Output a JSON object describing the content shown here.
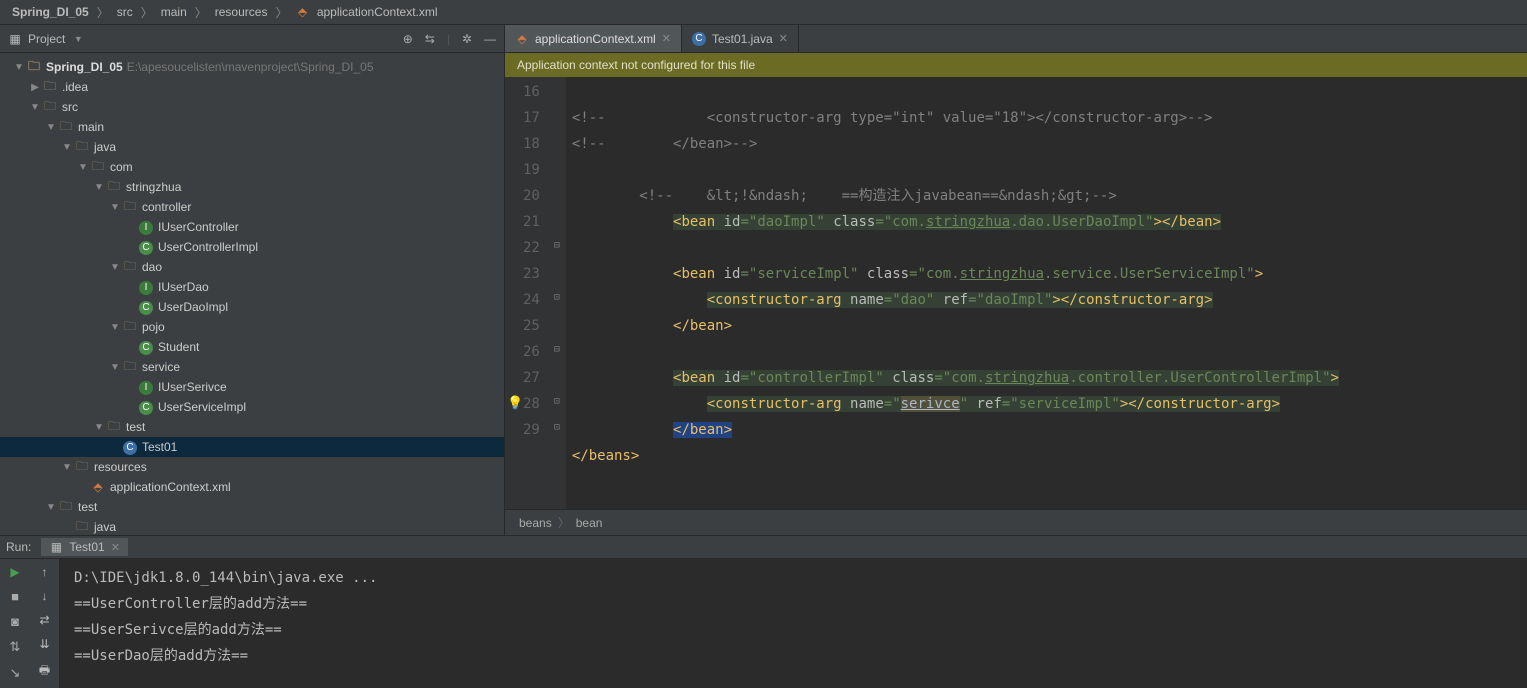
{
  "breadcrumb": {
    "items": [
      "Spring_DI_05",
      "src",
      "main",
      "resources",
      "applicationContext.xml"
    ]
  },
  "project_panel": {
    "title": "Project",
    "tree": [
      {
        "indent": 0,
        "arrow": "▼",
        "icon": "folder-b",
        "label": "Spring_DI_05",
        "hint": "E:\\apesoucelisten\\mavenproject\\Spring_DI_05",
        "bold": true
      },
      {
        "indent": 1,
        "arrow": "▶",
        "icon": "folder",
        "label": ".idea"
      },
      {
        "indent": 1,
        "arrow": "▼",
        "icon": "folder-b",
        "label": "src"
      },
      {
        "indent": 2,
        "arrow": "▼",
        "icon": "folder-b",
        "label": "main"
      },
      {
        "indent": 3,
        "arrow": "▼",
        "icon": "folder-b",
        "label": "java"
      },
      {
        "indent": 4,
        "arrow": "▼",
        "icon": "folder-b",
        "label": "com"
      },
      {
        "indent": 5,
        "arrow": "▼",
        "icon": "folder-b",
        "label": "stringzhua"
      },
      {
        "indent": 6,
        "arrow": "▼",
        "icon": "folder-b",
        "label": "controller"
      },
      {
        "indent": 7,
        "arrow": "",
        "icon": "interface",
        "label": "IUserController"
      },
      {
        "indent": 7,
        "arrow": "",
        "icon": "class",
        "label": "UserControllerImpl"
      },
      {
        "indent": 6,
        "arrow": "▼",
        "icon": "folder-b",
        "label": "dao"
      },
      {
        "indent": 7,
        "arrow": "",
        "icon": "interface",
        "label": "IUserDao"
      },
      {
        "indent": 7,
        "arrow": "",
        "icon": "class",
        "label": "UserDaoImpl"
      },
      {
        "indent": 6,
        "arrow": "▼",
        "icon": "folder-b",
        "label": "pojo"
      },
      {
        "indent": 7,
        "arrow": "",
        "icon": "class",
        "label": "Student"
      },
      {
        "indent": 6,
        "arrow": "▼",
        "icon": "folder-b",
        "label": "service"
      },
      {
        "indent": 7,
        "arrow": "",
        "icon": "interface",
        "label": "IUserSerivce"
      },
      {
        "indent": 7,
        "arrow": "",
        "icon": "class",
        "label": "UserServiceImpl"
      },
      {
        "indent": 5,
        "arrow": "▼",
        "icon": "folder-b",
        "label": "test"
      },
      {
        "indent": 6,
        "arrow": "",
        "icon": "java",
        "label": "Test01",
        "selected": true
      },
      {
        "indent": 3,
        "arrow": "▼",
        "icon": "folder-b",
        "label": "resources"
      },
      {
        "indent": 4,
        "arrow": "",
        "icon": "xml",
        "label": "applicationContext.xml"
      },
      {
        "indent": 2,
        "arrow": "▼",
        "icon": "folder-b",
        "label": "test"
      },
      {
        "indent": 3,
        "arrow": "",
        "icon": "folder-b",
        "label": "java"
      }
    ]
  },
  "editor": {
    "tabs": [
      {
        "icon": "xml",
        "label": "applicationContext.xml",
        "active": true
      },
      {
        "icon": "java",
        "label": "Test01.java",
        "active": false
      }
    ],
    "banner": "Application context not configured for this file",
    "gutter": [
      "16",
      "17",
      "18",
      "19",
      "20",
      "21",
      "22",
      "23",
      "24",
      "25",
      "26",
      "27",
      "28",
      "29"
    ],
    "bulb_at": 12,
    "fold_marks": {
      "6": "⊟",
      "8": "⊡",
      "10": "⊟",
      "12": "⊡",
      "13": "⊡"
    },
    "bottom_crumb": [
      "beans",
      "bean"
    ]
  },
  "code": {
    "l16": {
      "p": "<!--            <constructor-arg type=\"int\" value=\"18\"></constructor-arg>-->"
    },
    "l17": {
      "p": "<!--        </bean>-->"
    },
    "l19a": "<!--",
    "l19b": "&lt;!&ndash;",
    "l19c": "==构造注入javabean==&ndash;&gt;",
    "l19d": "-->",
    "l20_tag": "bean",
    "l20_id": "id",
    "l20_idv": "\"daoImpl\"",
    "l20_cls": "class",
    "l20_clsv1": "\"com.",
    "l20_clsv2": "stringzhua",
    "l20_clsv3": ".dao.UserDaoImpl\"",
    "l20_c": "bean",
    "l22_tag": "bean",
    "l22_id": "id",
    "l22_idv": "\"serviceImpl\"",
    "l22_cls": "class",
    "l22_clsv1": "\"com.",
    "l22_clsv2": "stringzhua",
    "l22_clsv3": ".service.UserServiceImpl\"",
    "l23_tag": "constructor-arg",
    "l23_n": "name",
    "l23_nv": "\"dao\"",
    "l23_r": "ref",
    "l23_rv": "\"daoImpl\"",
    "l23_c": "constructor-arg",
    "l24_c": "bean",
    "l26_tag": "bean",
    "l26_id": "id",
    "l26_idv": "\"controllerImpl\"",
    "l26_cls": "class",
    "l26_clsv1": "\"com.",
    "l26_clsv2": "stringzhua",
    "l26_clsv3": ".controller.UserControllerImpl\"",
    "l27_tag": "constructor-arg",
    "l27_n": "name",
    "l27_nv": "\"",
    "l27_nv2": "serivce",
    "l27_nv3": "\"",
    "l27_r": "ref",
    "l27_rv": "\"serviceImpl\"",
    "l27_c": "constructor-arg",
    "l28_c": "bean",
    "l29_c": "beans"
  },
  "run": {
    "label": "Run:",
    "tab": "Test01",
    "output": [
      "D:\\IDE\\jdk1.8.0_144\\bin\\java.exe ...",
      "==UserController层的add方法==",
      "==UserSerivce层的add方法==",
      "==UserDao层的add方法=="
    ]
  }
}
